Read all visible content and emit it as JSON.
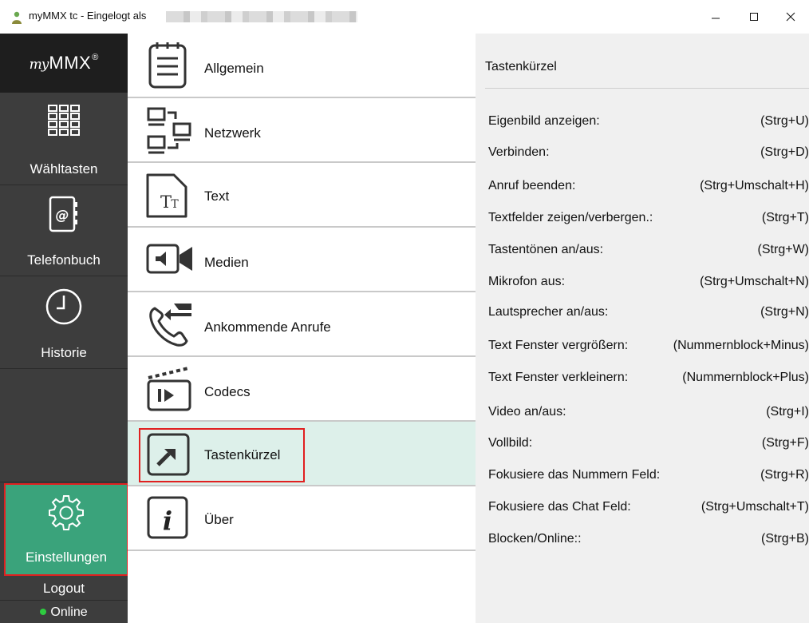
{
  "window": {
    "title": "myMMX tc - Eingelogt als",
    "controls": [
      "minimize-icon",
      "maximize-icon",
      "close-icon"
    ]
  },
  "nav": {
    "logo_my": "my",
    "logo_mmx": "MMX",
    "logo_reg": "®",
    "items": [
      {
        "label": "Wähltasten",
        "icon": "dialpad-icon"
      },
      {
        "label": "Telefonbuch",
        "icon": "contacts-book-icon"
      },
      {
        "label": "Historie",
        "icon": "clock-icon"
      }
    ],
    "settings_label": "Einstellungen",
    "logout_label": "Logout",
    "status_label": "Online"
  },
  "menu": {
    "items": [
      {
        "label": "Allgemein",
        "icon": "notepad-icon"
      },
      {
        "label": "Netzwerk",
        "icon": "network-icon"
      },
      {
        "label": "Text",
        "icon": "text-icon"
      },
      {
        "label": "Medien",
        "icon": "speaker-video-icon"
      },
      {
        "label": "Ankommende Anrufe",
        "icon": "incoming-call-icon"
      },
      {
        "label": "Codecs",
        "icon": "clapperboard-icon"
      },
      {
        "label": "Tastenkürzel",
        "icon": "shortcut-arrow-icon",
        "selected": true
      },
      {
        "label": "Über",
        "icon": "info-icon"
      }
    ]
  },
  "panel": {
    "title": "Tastenkürzel",
    "shortcuts": [
      {
        "name": "Eigenbild anzeigen:",
        "keys": "(Strg+U)"
      },
      {
        "name": "Verbinden:",
        "keys": "(Strg+D)"
      },
      {
        "name": "Anruf beenden:",
        "keys": "(Strg+Umschalt+H)"
      },
      {
        "name": "Textfelder zeigen/verbergen.:",
        "keys": "(Strg+T)"
      },
      {
        "name": "Tastentönen an/aus:",
        "keys": "(Strg+W)"
      },
      {
        "name": "Mikrofon aus:",
        "keys": "(Strg+Umschalt+N)"
      },
      {
        "name": "Lautsprecher an/aus:",
        "keys": "(Strg+N)"
      },
      {
        "name": "Text Fenster vergrößern:",
        "keys": "(Nummernblock+Minus)"
      },
      {
        "name": "Text Fenster verkleinern:",
        "keys": "(Nummernblock+Plus)"
      },
      {
        "name": "Video an/aus:",
        "keys": "(Strg+I)"
      },
      {
        "name": "Vollbild:",
        "keys": "(Strg+F)"
      },
      {
        "name": "Fokusiere das Nummern Feld:",
        "keys": "(Strg+R)"
      },
      {
        "name": "Fokusiere das Chat Feld:",
        "keys": "(Strg+Umschalt+T)"
      },
      {
        "name": "Blocken/Online::",
        "keys": "(Strg+B)"
      }
    ]
  },
  "colors": {
    "nav_bg": "#3d3d3d",
    "logo_bg": "#1e1e1e",
    "settings_active": "#3aa37b",
    "selected_row": "#ddf0ea",
    "highlight_border": "#e02020",
    "status_online": "#2ecc40",
    "panel_bg": "#f0f0f0"
  }
}
